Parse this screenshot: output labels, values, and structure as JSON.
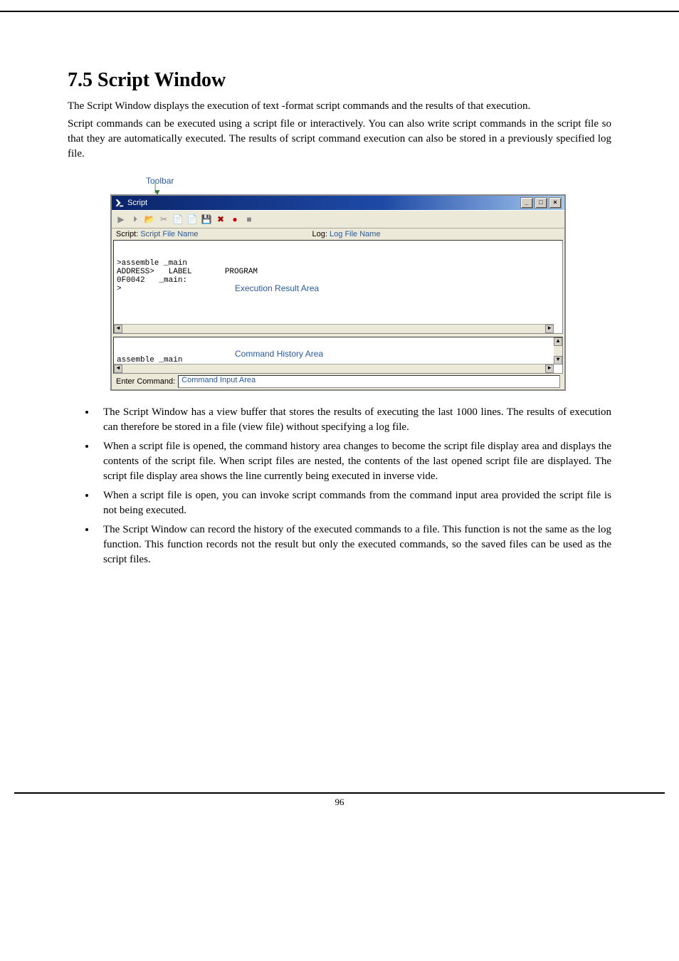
{
  "heading": "7.5 Script Window",
  "para1": "The Script Window displays the execution of text -format script commands and the results of that execution.",
  "para2": "Script commands can be executed using a script file or interactively. You can also write script commands in the script file so that they are automatically executed. The results of script command execution can also be stored in a previously specified log file.",
  "fig": {
    "toolbar_label": "Toolbar",
    "window_title": "Script",
    "script_label": "Script:",
    "script_value": "Script File Name",
    "log_label": "Log:",
    "log_value": "Log File Name",
    "result_text": ">assemble _main\nADDRESS>   LABEL       PROGRAM\n0F0042   _main:\n>",
    "result_overlay": "Execution Result Area",
    "history_text": "assemble _main",
    "history_overlay": "Command History Area",
    "cmd_label": "Enter Command:",
    "cmd_value": "Command Input Area"
  },
  "bullets": [
    "The Script Window has a view buffer that stores the results of executing the last 1000 lines. The results of execution can therefore be stored in a file (view file) without specifying a log file.",
    "When a script file is opened, the command history area changes to become the script file display area and displays the contents of the script file. When script files are nested, the contents of the last opened script file are displayed. The script file display area shows the line currently being executed in inverse vide.",
    "When a script file is open, you can invoke script commands from the command input area provided the script file is not being executed.",
    "The Script Window can record the history of the executed commands to a file. This function is not the same as the log function. This function records not the result but only the executed commands, so the saved files can be used as the script files."
  ],
  "page_number": "96"
}
